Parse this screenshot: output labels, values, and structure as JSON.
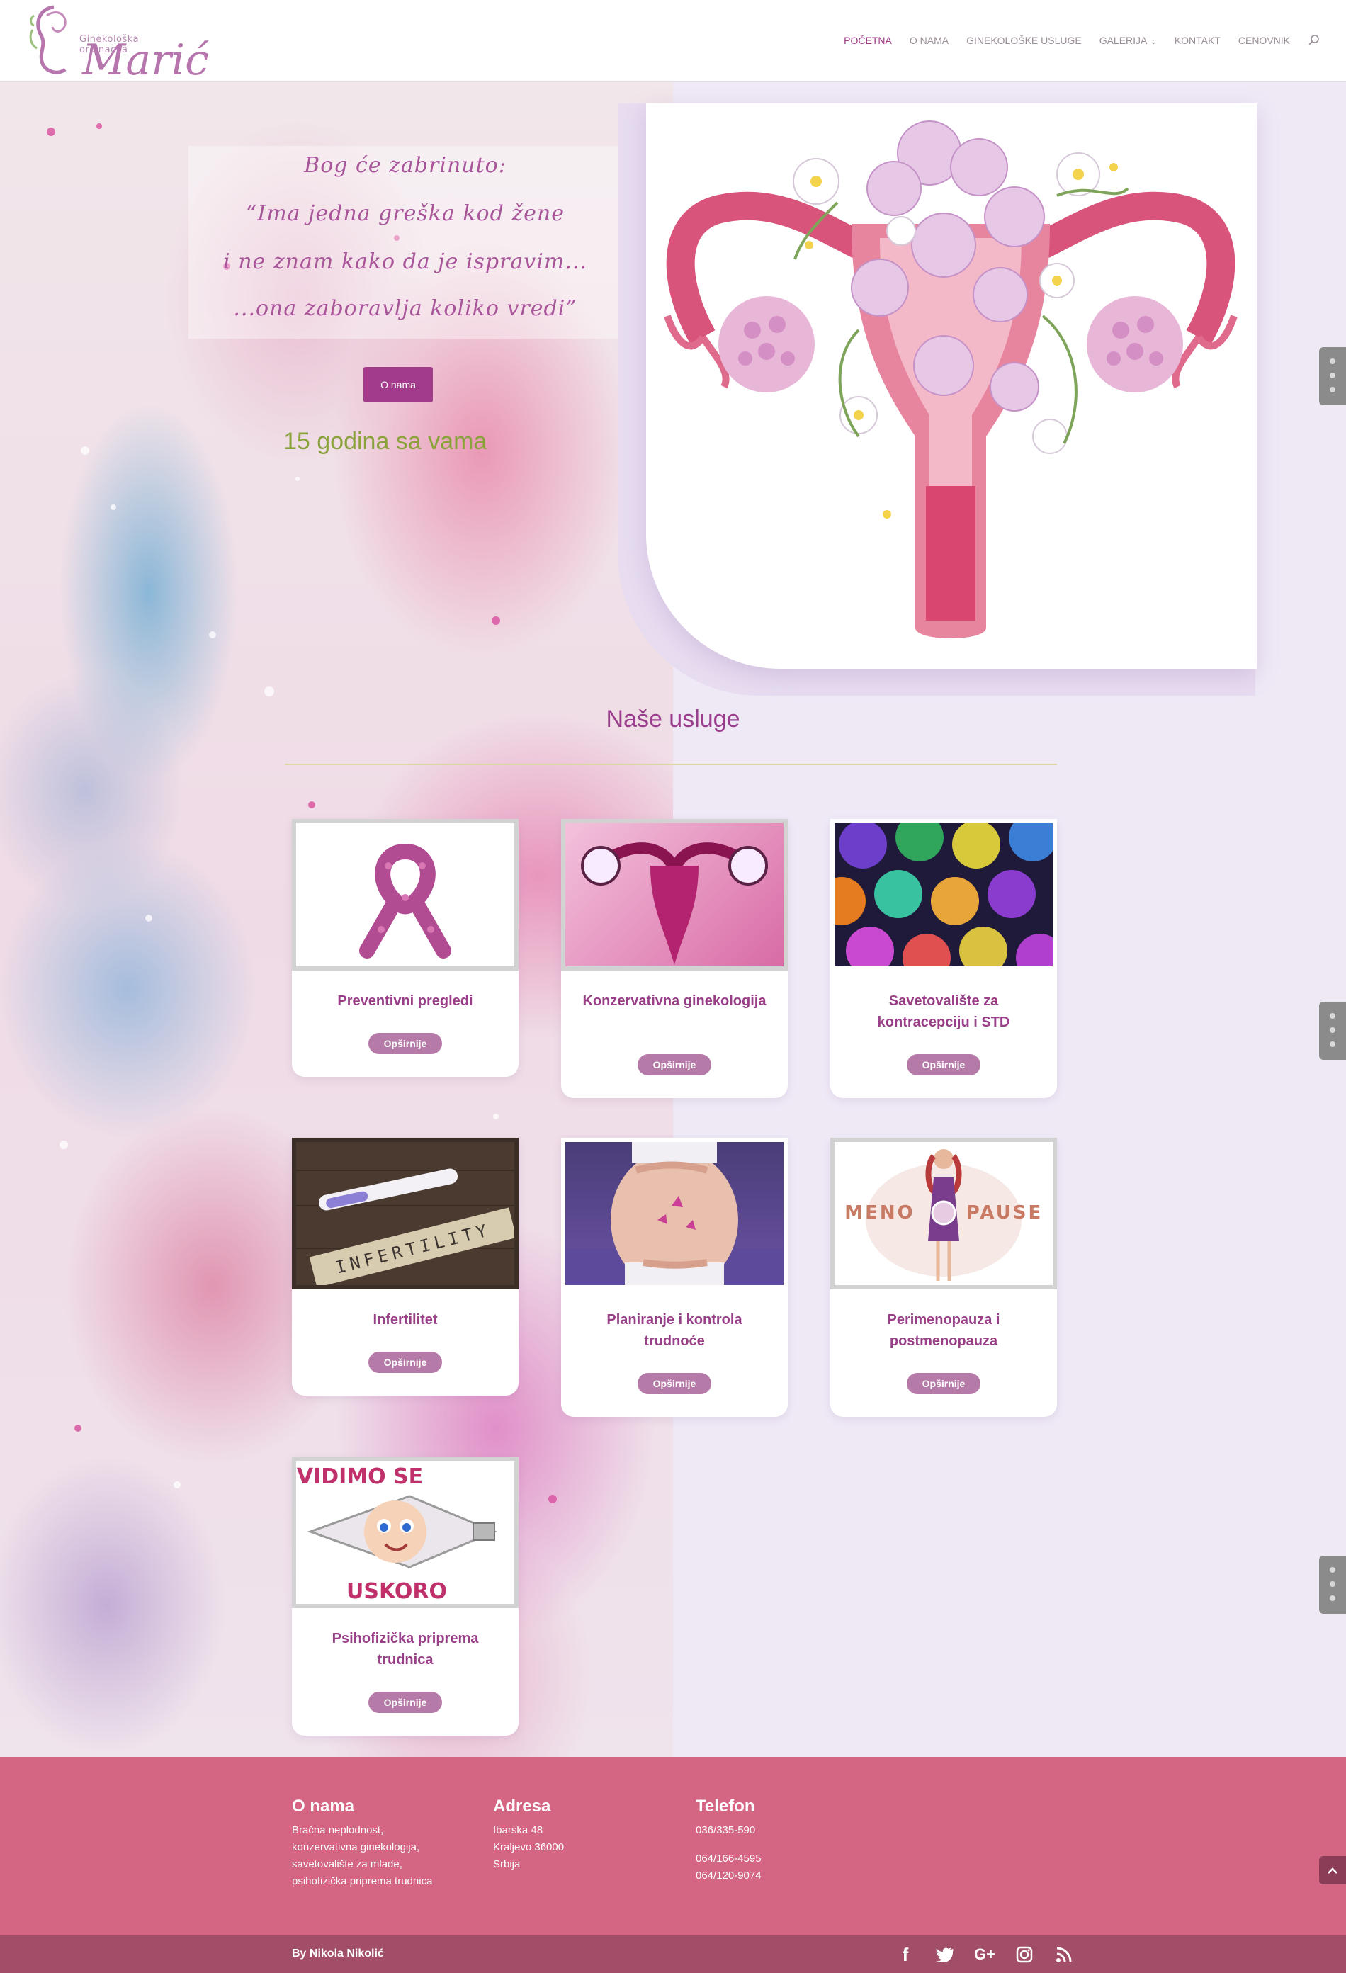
{
  "header": {
    "logo_small": "Ginekološka ordinacija",
    "logo_big": "Marić",
    "nav": [
      {
        "label": "POČETNA"
      },
      {
        "label": "O NAMA"
      },
      {
        "label": "GINEKOLOŠKE USLUGE"
      },
      {
        "label": "GALERIJA"
      },
      {
        "label": "KONTAKT"
      },
      {
        "label": "CENOVNIK"
      }
    ],
    "search_icon": "search-icon"
  },
  "hero": {
    "quote": [
      "Bog će zabrinuto:",
      "“Ima jedna greška kod žene",
      "i ne znam kako da je ispravim...",
      "...ona zaboravlja koliko vredi”"
    ],
    "button": "O nama",
    "years": "15 godina sa vama",
    "image_icon": "uterus-flowers-illustration"
  },
  "services": {
    "title": "Naše usluge",
    "button_label": "Opširnije",
    "items": [
      {
        "title": "Preventivni pregledi",
        "icon": "ribbon-hearts-image"
      },
      {
        "title": "Konzervativna ginekologija",
        "icon": "uterus-image"
      },
      {
        "title": "Savetovalište za kontracepciju i STD",
        "icon": "condoms-image"
      },
      {
        "title": "Infertilitet",
        "icon": "infertility-image"
      },
      {
        "title": "Planiranje i kontrola trudnoće",
        "icon": "pregnancy-image"
      },
      {
        "title": "Perimenopauza i postmenopauza",
        "icon": "menopause-image"
      },
      {
        "title": "Psihofizička priprema trudnica",
        "icon": "vidimo-se-uskoro-image"
      }
    ],
    "img_text": {
      "infertility": "INFERTILITY",
      "meno_left": "MENO",
      "meno_right": "PAUSE",
      "vidimo": "VIDIMO SE",
      "uskoro": "USKORO"
    }
  },
  "footer": {
    "about": {
      "title": "O nama",
      "lines": [
        "Bračna neplodnost,",
        "konzervativna ginekologija,",
        "savetovalište za mlade,",
        "psihofizička priprema trudnica"
      ]
    },
    "address": {
      "title": "Adresa",
      "lines": [
        "Ibarska 48",
        "Kraljevo 36000",
        "Srbija"
      ]
    },
    "phone": {
      "title": "Telefon",
      "line1": "036/335-590",
      "line2": "064/166-4595",
      "line3": "064/120-9074"
    },
    "credit": "By Nikola Nikolić",
    "socials": [
      "facebook-icon",
      "twitter-icon",
      "google-plus-icon",
      "instagram-icon",
      "rss-icon"
    ],
    "social_glyphs": {
      "facebook": "f",
      "google": "G+"
    }
  },
  "colors": {
    "accent": "#a23b8c",
    "footer": "#d46583",
    "bottom_bar": "#a24e68",
    "years": "#8aa23a"
  }
}
